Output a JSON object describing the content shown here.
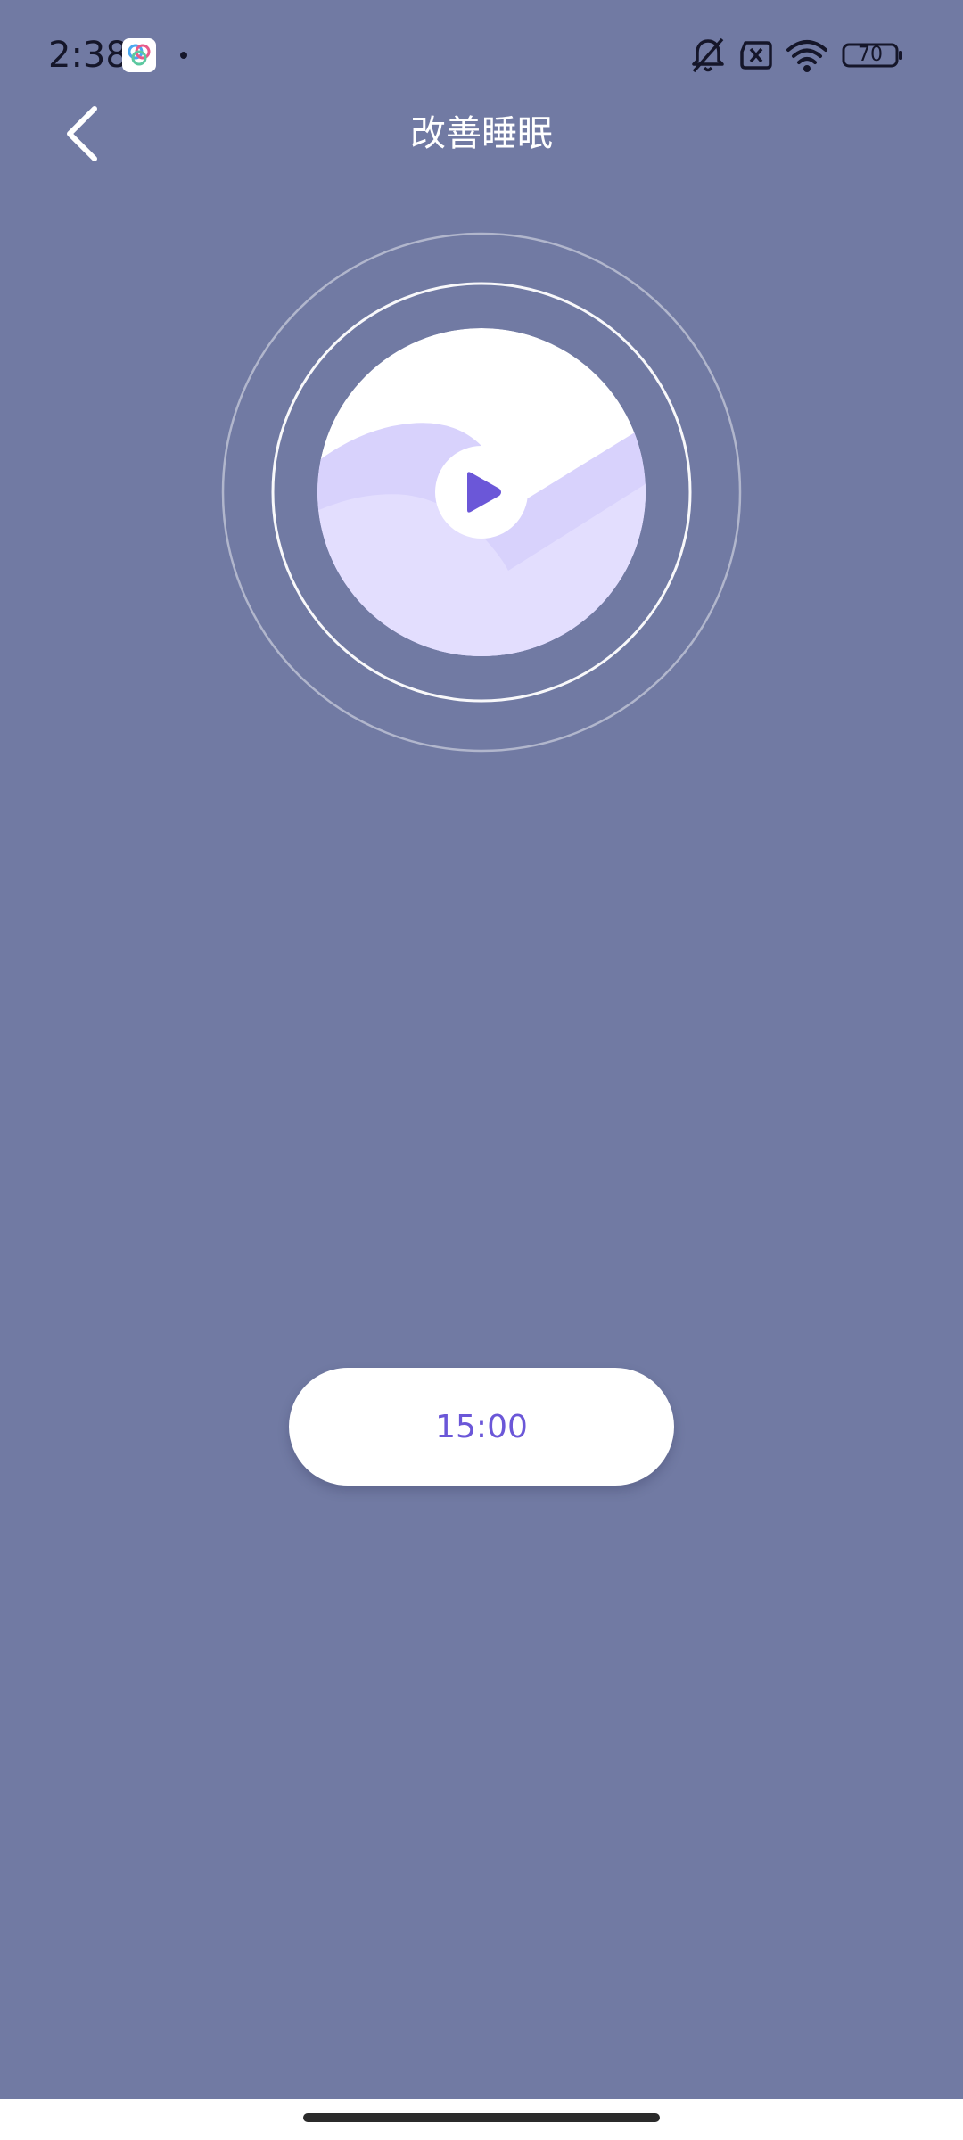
{
  "status_bar": {
    "time": "2:38",
    "battery_level": "70",
    "icons": [
      "app-icon",
      "notification-dot",
      "mute-bell-icon",
      "sim-error-icon",
      "wifi-icon",
      "battery-icon"
    ]
  },
  "header": {
    "title": "改善睡眠",
    "back_icon": "chevron-left-icon"
  },
  "player": {
    "play_icon": "play-icon"
  },
  "timer": {
    "label": "15:00"
  },
  "colors": {
    "background": "#717aa3",
    "accent": "#6b57d8",
    "disc_light": "#e1dcfd",
    "disc_mid": "#d5cffb"
  }
}
